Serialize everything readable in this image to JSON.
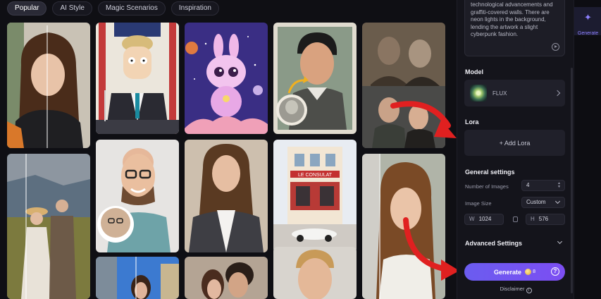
{
  "tabs": [
    "Popular",
    "AI Style",
    "Magic Scenarios",
    "Inspiration"
  ],
  "prompt": {
    "text": "technological advancements and graffiti-covered walls. There are neon lights in the background, lending the artwork a slight cyberpunk fashion."
  },
  "model": {
    "section_label": "Model",
    "name": "FLUX"
  },
  "lora": {
    "section_label": "Lora",
    "add_label": "+ Add Lora"
  },
  "general_settings": {
    "section_label": "General settings",
    "number_of_images_label": "Number of Images",
    "number_of_images_value": "4",
    "image_size_label": "Image Size",
    "image_size_value": "Custom",
    "width_label": "W",
    "width_value": "1024",
    "height_label": "H",
    "height_value": "576"
  },
  "advanced_settings": {
    "label": "Advanced Settings"
  },
  "generate": {
    "label": "Generate",
    "credits": "8",
    "help": "?"
  },
  "disclaimer": {
    "label": "Disclaimer",
    "info": "i"
  },
  "rail": {
    "generate_label": "Generate",
    "icon": "sparkle-icon"
  },
  "gallery": {
    "sign_text": "LE CONSULAT",
    "items": [
      "portrait-young-woman-braid",
      "cartoon-man-at-podium",
      "cute-pink-bunny-astronaut",
      "colorized-man-photo",
      "vintage-couple-photo",
      "couple-in-field",
      "smiling-man-glasses",
      "woman-in-blazer",
      "cafe-le-consulat",
      "woman-portrait-comparison",
      "woman-with-building",
      "couple-photo",
      "young-man-portrait"
    ]
  },
  "colors": {
    "accent": "#6b5cf0",
    "arrow": "#e02020",
    "panel": "#14141b"
  }
}
